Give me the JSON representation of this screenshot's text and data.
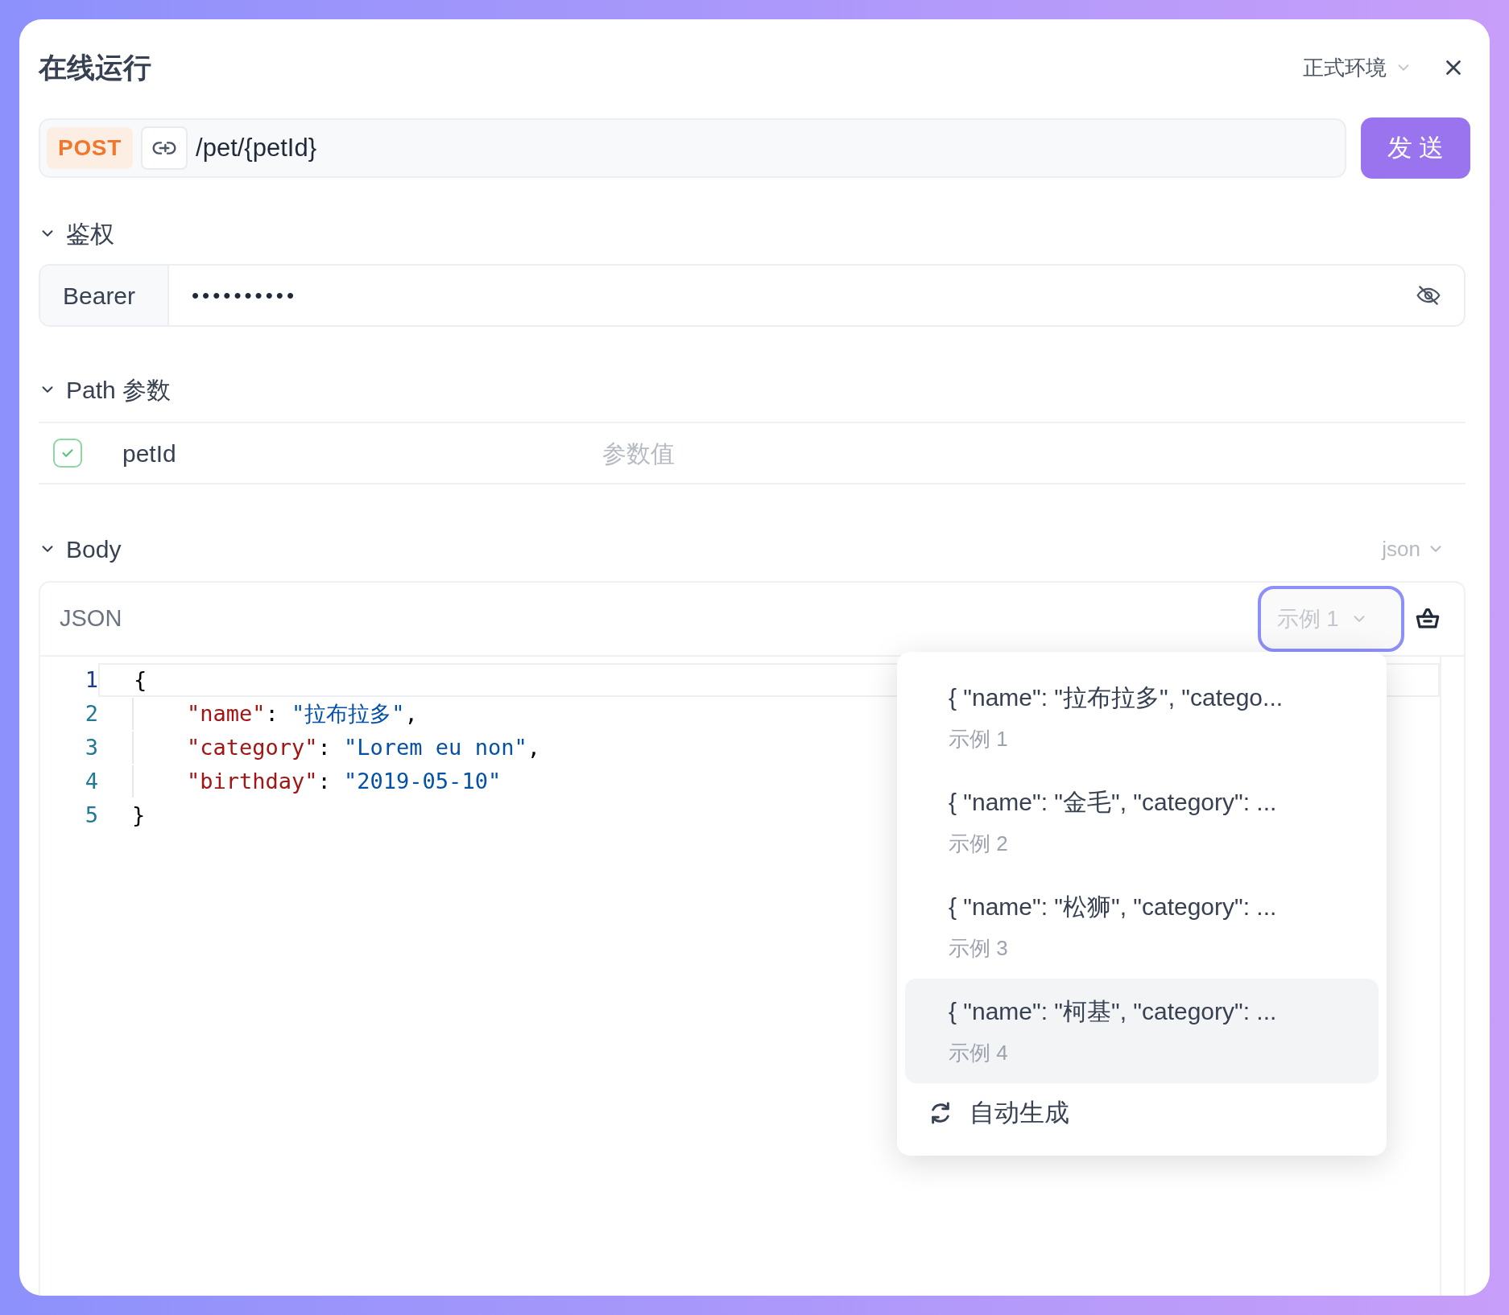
{
  "window": {
    "title": "在线运行",
    "environment": "正式环境"
  },
  "request": {
    "method": "POST",
    "path": "/pet/{petId}",
    "send_label": "发 送"
  },
  "auth": {
    "title": "鉴权",
    "expanded": true,
    "scheme": "Bearer",
    "token": "••••••••••"
  },
  "path_params": {
    "title": "Path 参数",
    "expanded": true,
    "rows": [
      {
        "checked": true,
        "name": "petId",
        "placeholder": "参数值"
      }
    ]
  },
  "body": {
    "title": "Body",
    "expanded": true,
    "format": "json",
    "editor_label": "JSON",
    "example_selector": "示例 1",
    "code": [
      {
        "number": "1",
        "indent": false,
        "current": true,
        "tokens": [
          {
            "kind": "punct",
            "text": "{"
          }
        ]
      },
      {
        "number": "2",
        "indent": true,
        "current": false,
        "tokens": [
          {
            "kind": "key",
            "text": "\"name\""
          },
          {
            "kind": "punct",
            "text": ": "
          },
          {
            "kind": "string",
            "text": "\"拉布拉多\""
          },
          {
            "kind": "punct",
            "text": ","
          }
        ]
      },
      {
        "number": "3",
        "indent": true,
        "current": false,
        "tokens": [
          {
            "kind": "key",
            "text": "\"category\""
          },
          {
            "kind": "punct",
            "text": ": "
          },
          {
            "kind": "string",
            "text": "\"Lorem eu non\""
          },
          {
            "kind": "punct",
            "text": ","
          }
        ]
      },
      {
        "number": "4",
        "indent": true,
        "current": false,
        "tokens": [
          {
            "kind": "key",
            "text": "\"birthday\""
          },
          {
            "kind": "punct",
            "text": ": "
          },
          {
            "kind": "string",
            "text": "\"2019-05-10\""
          }
        ]
      },
      {
        "number": "5",
        "indent": false,
        "current": false,
        "tokens": [
          {
            "kind": "punct",
            "text": "}"
          }
        ]
      }
    ],
    "examples_menu": {
      "items": [
        {
          "preview": "{ \"name\": \"拉布拉多\", \"catego...",
          "label": "示例 1",
          "hovered": false
        },
        {
          "preview": "{ \"name\": \"金毛\", \"category\": ...",
          "label": "示例 2",
          "hovered": false
        },
        {
          "preview": "{ \"name\": \"松狮\", \"category\": ...",
          "label": "示例 3",
          "hovered": false
        },
        {
          "preview": "{ \"name\": \"柯基\", \"category\": ...",
          "label": "示例 4",
          "hovered": true
        }
      ],
      "auto_generate": "自动生成"
    }
  }
}
